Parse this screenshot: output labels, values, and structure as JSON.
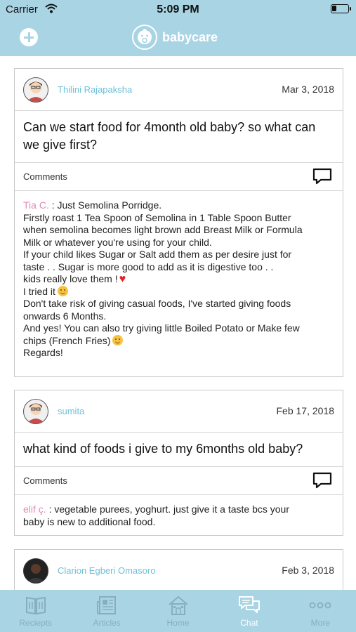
{
  "status_bar": {
    "carrier": "Carrier",
    "time": "5:09 PM",
    "battery_level": 0.3
  },
  "header": {
    "brand_name": "babycare",
    "add_icon": "plus-circle-icon",
    "logo_icon": "baby-face-icon"
  },
  "posts": [
    {
      "author": "Thilini Rajapaksha",
      "date": "Mar 3, 2018",
      "question": "Can we start food for 4month old baby? so what can we give first?",
      "comments_label": "Comments",
      "comment": {
        "name": "Tia C.",
        "lines": [
          " : Just Semolina Porridge.",
          "Firstly roast 1 Tea Spoon of Semolina in 1 Table Spoon Butter",
          "when semolina becomes light brown add Breast Milk or Formula",
          "Milk or whatever you're using for your child.",
          "If your child likes Sugar or Salt add them  as per desire just for",
          "taste . . Sugar is more good to add as it is digestive too . .",
          "kids really love them !",
          "I tried it",
          "Don't take risk of giving casual foods, I've started giving foods",
          "onwards 6 Months.",
          "And yes! You can also try giving little Boiled Potato or Make few",
          "chips (French Fries)",
          "Regards!"
        ]
      }
    },
    {
      "author": "sumita",
      "date": "Feb 17, 2018",
      "question": "what kind of foods i give to my 6months old baby?",
      "comments_label": "Comments",
      "comment": {
        "name": "elif ç.",
        "lines": [
          " : vegetable purees, yoghurt. just give it a taste bcs your",
          "baby is new to additional food."
        ]
      }
    },
    {
      "author": "Clarion Egberi Omasoro",
      "date": "Feb 3, 2018"
    }
  ],
  "tabs": [
    {
      "label": "Reciepts",
      "icon": "book-icon"
    },
    {
      "label": "Articles",
      "icon": "newspaper-icon"
    },
    {
      "label": "Home",
      "icon": "house-icon"
    },
    {
      "label": "Chat",
      "icon": "chat-bubbles-icon",
      "active": true
    },
    {
      "label": "More",
      "icon": "more-dots-icon"
    }
  ],
  "colors": {
    "bar": "#a9d4e4",
    "author": "#6fbfd8",
    "commenter": "#e08bb5"
  }
}
